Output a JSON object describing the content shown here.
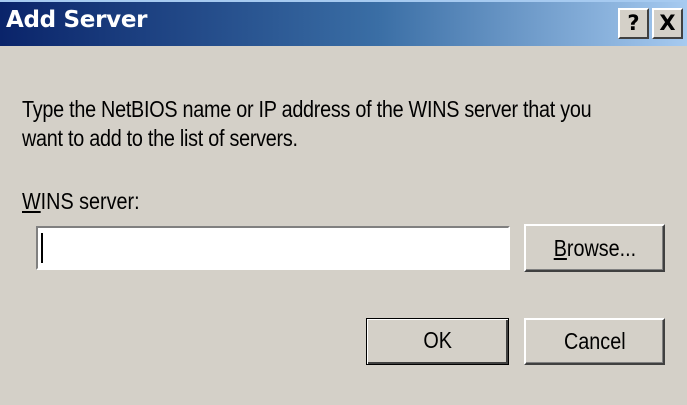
{
  "window": {
    "title": "Add Server",
    "help_label": "?",
    "close_label": "X"
  },
  "content": {
    "instruction_line1": "Type the NetBIOS name or IP address of the WINS server that you",
    "instruction_line2": "want to add to the list of servers.",
    "field_label_accel": "W",
    "field_label_rest": "INS server:",
    "wins_server_value": ""
  },
  "buttons": {
    "browse_accel": "B",
    "browse_rest": "rowse...",
    "ok": "OK",
    "cancel": "Cancel"
  },
  "colors": {
    "title_gradient_start": "#0a246a",
    "title_gradient_end": "#a6caf0",
    "dialog_face": "#d4d0c8"
  }
}
